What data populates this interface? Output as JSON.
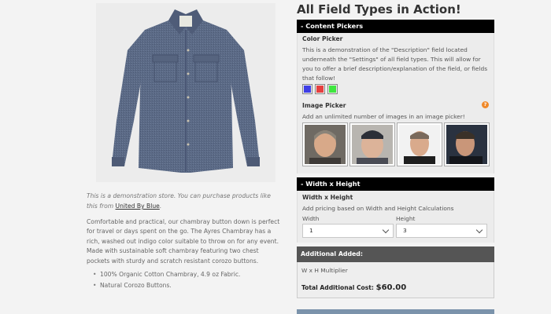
{
  "left": {
    "demo_note_prefix": "This is a demonstration store. You can purchase products like this from ",
    "demo_note_link": "United By Blue",
    "demo_note_suffix": ".",
    "description": "Comfortable and practical, our chambray button down is perfect for travel or days spent on the go. The Ayres Chambray has a rich, washed out indigo color suitable to throw on for any event. Made with sustainable soft chambray featuring two chest pockets with sturdy and scratch resistant corozo buttons.",
    "bullets": [
      "100% Organic Cotton Chambray, 4.9 oz Fabric.",
      "Natural Corozo Buttons."
    ]
  },
  "right": {
    "title": "All Field Types in Action!",
    "content_pickers": {
      "header": "- Content Pickers",
      "color_picker_label": "Color Picker",
      "color_picker_help": "This is a demonstration of the \"Description\" field located underneath the \"Settings\" of all field types. This will allow for you to offer a brief description/explanation of the field, or fields that follow!",
      "colors": [
        "#3f3fe6",
        "#e63f3f",
        "#3fe63f"
      ],
      "image_picker_label": "Image Picker",
      "image_picker_help": "Add an unlimited number of images in an image picker!",
      "help_icon": "?"
    },
    "width_height": {
      "header": "- Width x Height",
      "label": "Width x Height",
      "help": "Add pricing based on Width and Height Calculations",
      "width_label": "Width",
      "width_value": "1",
      "height_label": "Height",
      "height_value": "3"
    },
    "additional": {
      "header": "Additional Added:",
      "line": "W x H Multiplier",
      "total_label": "Total Additional Cost:",
      "total_value": "$60.00"
    }
  }
}
